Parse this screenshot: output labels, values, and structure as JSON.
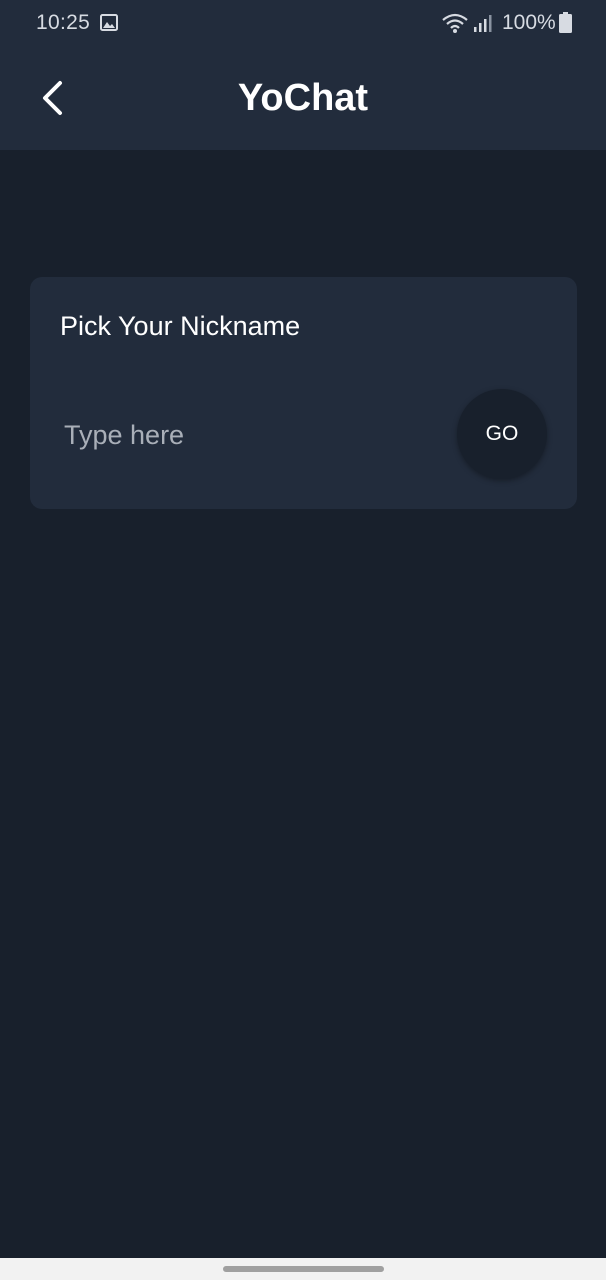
{
  "status_bar": {
    "time": "10:25",
    "battery": "100%",
    "icons": [
      "gallery-icon",
      "wifi-icon",
      "signal-icon",
      "battery-icon"
    ]
  },
  "app_bar": {
    "title": "YoChat",
    "back_icon": "chevron-left-icon"
  },
  "nickname_card": {
    "title": "Pick Your Nickname",
    "input_value": "",
    "input_placeholder": "Type here",
    "go_label": "GO"
  },
  "colors": {
    "background": "#18202c",
    "surface": "#222c3c",
    "text": "#ffffff",
    "placeholder": "#a9afb8"
  }
}
